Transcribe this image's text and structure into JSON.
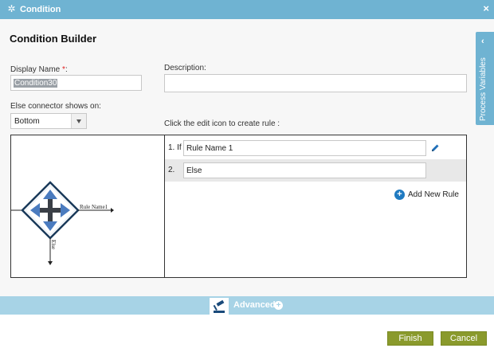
{
  "window": {
    "title": "Condition",
    "close_label": "×"
  },
  "page": {
    "heading": "Condition Builder"
  },
  "form": {
    "display_name_label": "Display Name ",
    "display_name_required": "*",
    "display_name_colon": ":",
    "display_name_value": "Condition30",
    "description_label": "Description:",
    "description_value": "",
    "else_connector_label": "Else connector shows on:",
    "else_connector_value": "Bottom",
    "edit_hint": "Click the edit icon to create rule :"
  },
  "side_panel": {
    "label": "Process Variables"
  },
  "diagram": {
    "rule_label": "Rule Name1",
    "else_label": "Else"
  },
  "rules": [
    {
      "number": "1. If",
      "name": "Rule Name 1"
    },
    {
      "number": "2.",
      "name": "Else"
    }
  ],
  "add_rule_label": "Add New Rule",
  "advanced_label": "Advanced",
  "buttons": {
    "finish": "Finish",
    "cancel": "Cancel"
  },
  "colors": {
    "header": "#6fb3d2",
    "advanced_bar": "#a7d3e6",
    "button": "#8a9a2c",
    "accent": "#1f7ac1"
  }
}
